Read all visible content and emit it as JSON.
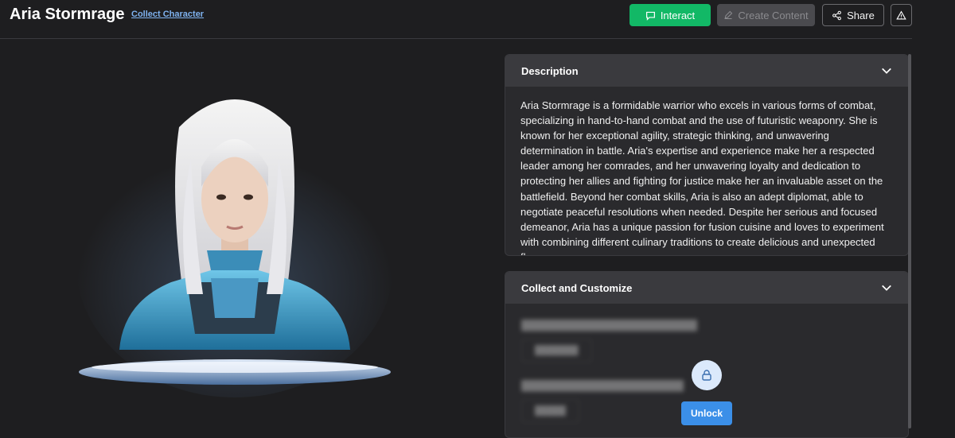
{
  "header": {
    "title": "Aria Stormrage",
    "collect_link": "Collect Character",
    "interact_label": "Interact",
    "create_label": "Create Content",
    "share_label": "Share"
  },
  "description": {
    "heading": "Description",
    "text": "Aria Stormrage is a formidable warrior who excels in various forms of combat, specializing in hand-to-hand combat and the use of futuristic weaponry. She is known for her exceptional agility, strategic thinking, and unwavering determination in battle. Aria's expertise and experience make her a respected leader among her comrades, and her unwavering loyalty and dedication to protecting her allies and fighting for justice make her an invaluable asset on the battlefield. Beyond her combat skills, Aria is also an adept diplomat, able to negotiate peaceful resolutions when needed. Despite her serious and focused demeanor, Aria has a unique passion for fusion cuisine and loves to experiment with combining different culinary traditions to create delicious and unexpected flavors."
  },
  "collect": {
    "heading": "Collect and Customize",
    "unlock_label": "Unlock"
  },
  "colors": {
    "interact": "#12b866",
    "unlock": "#3b8fe8",
    "background": "#1e1e20"
  }
}
